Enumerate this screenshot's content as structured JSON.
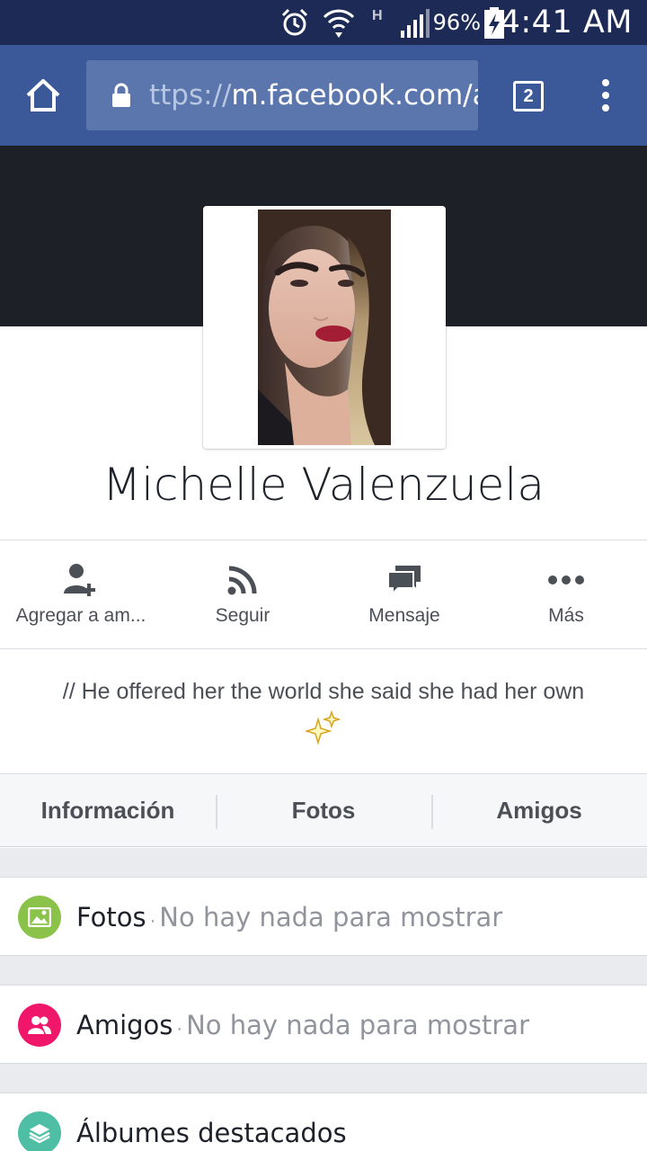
{
  "status_bar": {
    "battery_percent": "96%",
    "time": "4:41 AM",
    "network_type": "H",
    "icons": [
      "alarm-icon",
      "wifi-icon",
      "signal-icon",
      "battery-charging-icon"
    ]
  },
  "browser": {
    "url_scheme": "ttps://",
    "url_host": "m.facebook.com/a",
    "tab_count": "2",
    "toolbar_color": "#3b5998"
  },
  "profile": {
    "name": "Michelle Valenzuela",
    "bio": "// He offered her the world she said she had her own"
  },
  "actions": [
    {
      "label": "Agregar a am...",
      "icon": "add-friend-icon"
    },
    {
      "label": "Seguir",
      "icon": "follow-icon"
    },
    {
      "label": "Mensaje",
      "icon": "message-icon"
    },
    {
      "label": "Más",
      "icon": "more-icon"
    }
  ],
  "tabs": [
    "Información",
    "Fotos",
    "Amigos"
  ],
  "sections": [
    {
      "title": "Fotos",
      "empty_text": "No hay nada para mostrar",
      "icon": "photos-icon",
      "color": "#8bc34a"
    },
    {
      "title": "Amigos",
      "empty_text": "No hay nada para mostrar",
      "icon": "friends-icon",
      "color": "#f0176a"
    },
    {
      "title": "Álbumes destacados",
      "icon": "albums-icon",
      "color": "#4ebfa5"
    }
  ]
}
